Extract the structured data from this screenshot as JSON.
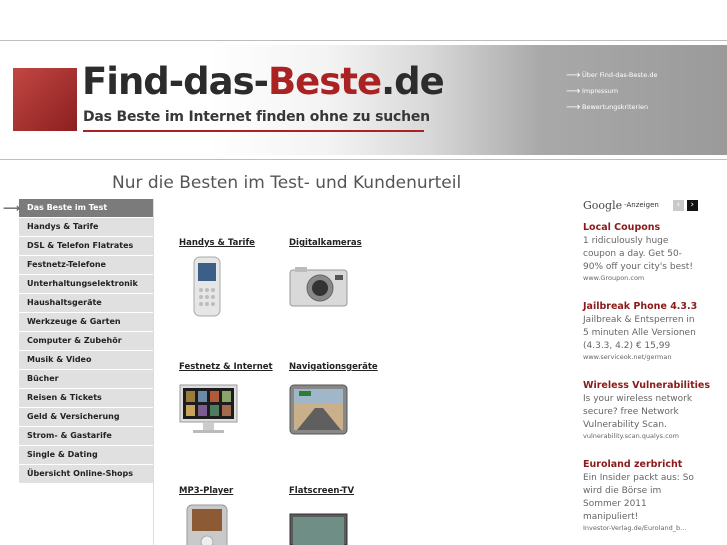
{
  "site": {
    "logo_part1": "Find-das-",
    "logo_part2": "Beste",
    "logo_part3": ".de",
    "tagline": "Das Beste im Internet finden ohne zu suchen",
    "colors": {
      "brand_red": "#ab2222",
      "nav_active": "#7b7b7b",
      "ad_title": "#8b1a1a"
    }
  },
  "top_links": [
    "Über Find-das-Beste.de",
    "Impressum",
    "Bewertungskriterien"
  ],
  "headline": "Nur die Besten im Test- und Kundenurteil",
  "nav": {
    "items": [
      "Das Beste im Test",
      "Handys & Tarife",
      "DSL & Telefon Flatrates",
      "Festnetz-Telefone",
      "Unterhaltungselektronik",
      "Haushaltsgeräte",
      "Werkzeuge & Garten",
      "Computer & Zubehör",
      "Musik & Video",
      "Bücher",
      "Reisen & Tickets",
      "Geld & Versicherung",
      "Strom- & Gastarife",
      "Single & Dating",
      "Übersicht Online-Shops"
    ],
    "active_icon": "arrow-right-icon"
  },
  "products": [
    {
      "label": "Handys & Tarife",
      "icon": "mobile-phone-image"
    },
    {
      "label": "Digitalkameras",
      "icon": "camera-image"
    },
    {
      "label": "Festnetz & Internet",
      "icon": "monitor-image"
    },
    {
      "label": "Navigationsgeräte",
      "icon": "gps-device-image"
    },
    {
      "label": "MP3-Player",
      "icon": "mp3-player-image"
    },
    {
      "label": "Flatscreen-TV",
      "icon": "tv-image"
    }
  ],
  "ads": {
    "provider": "Google",
    "label": "-Anzeigen",
    "items": [
      {
        "title": "Local Coupons",
        "lines": [
          "1 ridiculously huge",
          "coupon a day. Get 50-",
          "90% off your city's best!"
        ],
        "url": "www.Groupon.com"
      },
      {
        "title": "Jailbreak Phone 4.3.3",
        "lines": [
          "Jailbreak & Entsperren in",
          "5 minuten Alle Versionen",
          "(4.3.3, 4.2) € 15,99"
        ],
        "url": "www.serviceok.net/german"
      },
      {
        "title": "Wireless Vulnerabilities",
        "lines": [
          "Is your wireless network",
          "secure? free Network",
          "Vulnerability Scan."
        ],
        "url": "vulnerability.scan.qualys.com"
      },
      {
        "title": "Euroland zerbricht",
        "lines": [
          "Ein Insider packt aus: So",
          "wird die Börse im",
          "Sommer 2011",
          "manipuliert!"
        ],
        "url": "Investor-Verlag.de/Euroland_b..."
      }
    ]
  }
}
